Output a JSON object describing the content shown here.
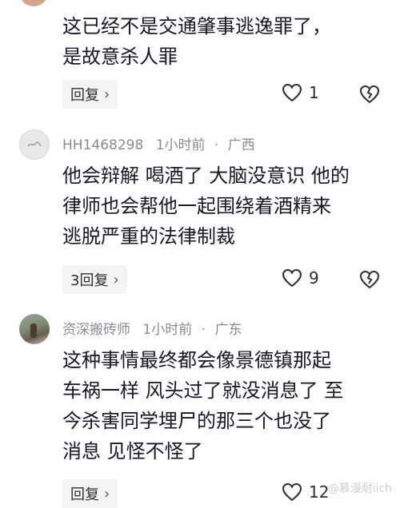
{
  "comment1": {
    "lines": [
      "这已经不是交通肇事逃逸罪了，",
      "是故意杀人罪"
    ],
    "reply_label": "回复",
    "like_count": "1"
  },
  "comment2": {
    "username": "HH1468298",
    "time": "1小时前",
    "location": "广西",
    "lines": [
      "他会辩解 喝酒了 大脑没意识 他的",
      "律师也会帮他一起围绕着酒精来",
      "逃脱严重的法律制裁"
    ],
    "reply_label": "3回复",
    "like_count": "9"
  },
  "comment3": {
    "username": "资深搬砖师",
    "time": "1小时前",
    "location": "广东",
    "lines": [
      "这种事情最终都会像景德镇那起",
      "车祸一样 风头过了就没消息了 至",
      "今杀害同学埋尸的那三个也没了",
      "消息 见怪不怪了"
    ],
    "reply_label": "回复",
    "like_count": "12"
  },
  "separator": "·",
  "chevron": "›",
  "watermark": "@慕漫耐iich",
  "icons": [
    "heart-outline-icon",
    "broken-heart-icon",
    "chevron-right-icon",
    "avatar-icon"
  ],
  "colors": {
    "text": "#161823",
    "meta": "#8a8b91",
    "button_bg": "#f4f4f5"
  }
}
